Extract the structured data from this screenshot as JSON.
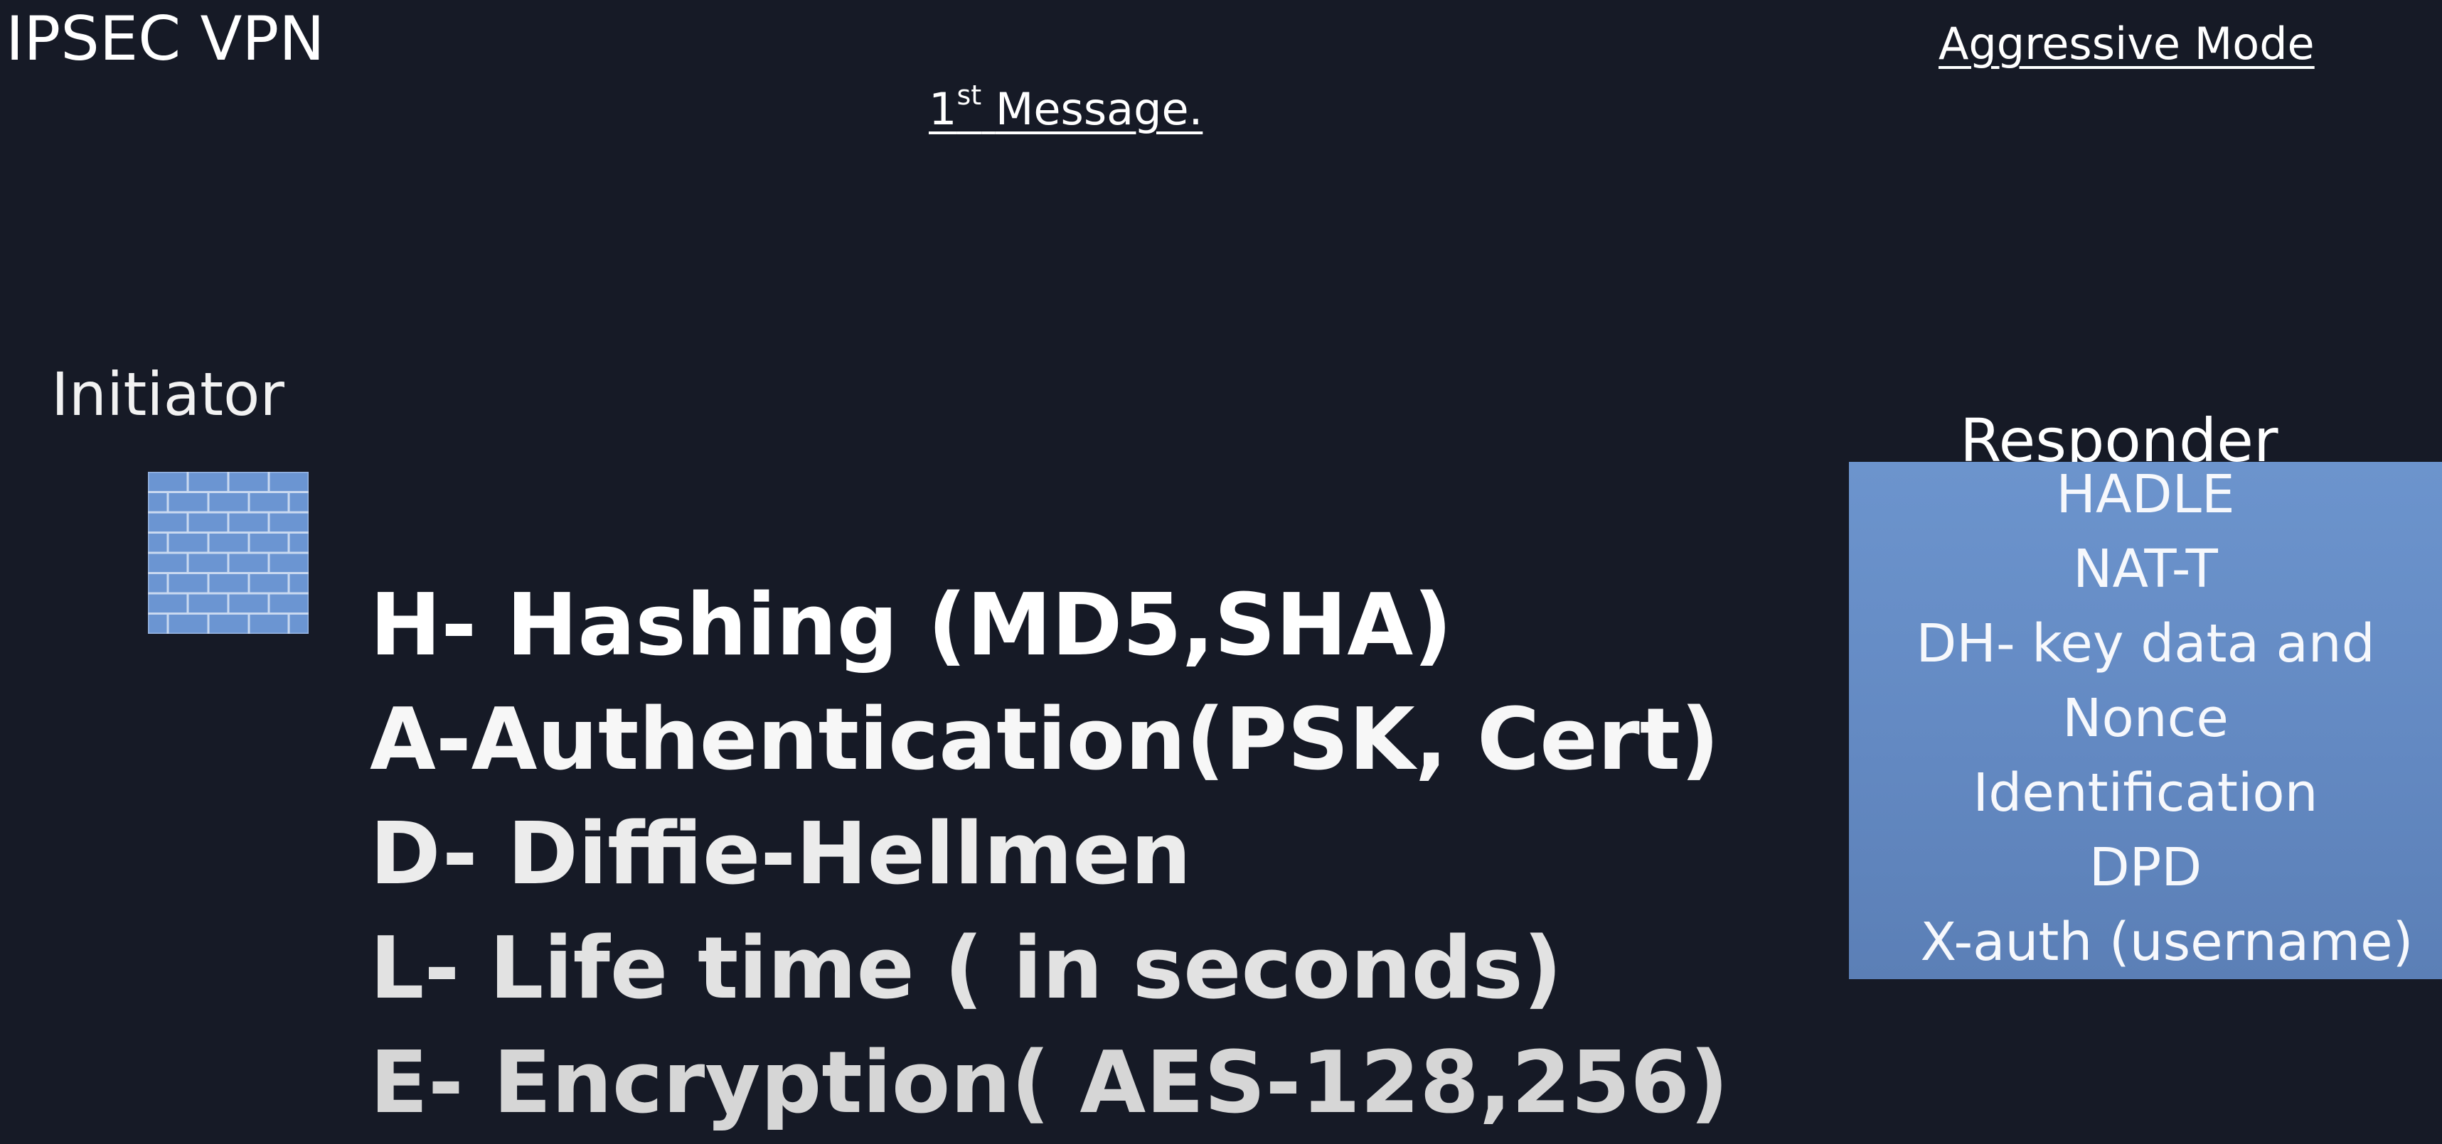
{
  "header": {
    "title": "IPSEC VPN",
    "mode": "Aggressive Mode"
  },
  "message": {
    "number": "1",
    "superscript": "st",
    "label": "Message."
  },
  "initiator": {
    "label": "Initiator",
    "icon": "firewall-icon"
  },
  "hadle": [
    "H- Hashing (MD5,SHA)",
    "A-Authentication(PSK, Cert)",
    "D- Diffie-Hellmen",
    "L- Life time ( in seconds)",
    "E- Encryption( AES-128,256)"
  ],
  "responder": {
    "label": "Responder",
    "items": [
      "HADLE",
      "NAT-T",
      "DH- key data and",
      "Nonce",
      "Identification",
      "DPD",
      "X-auth (username)"
    ]
  },
  "colors": {
    "background": "#161a26",
    "box": "#6389c2",
    "firewall": "#6b95d2"
  }
}
